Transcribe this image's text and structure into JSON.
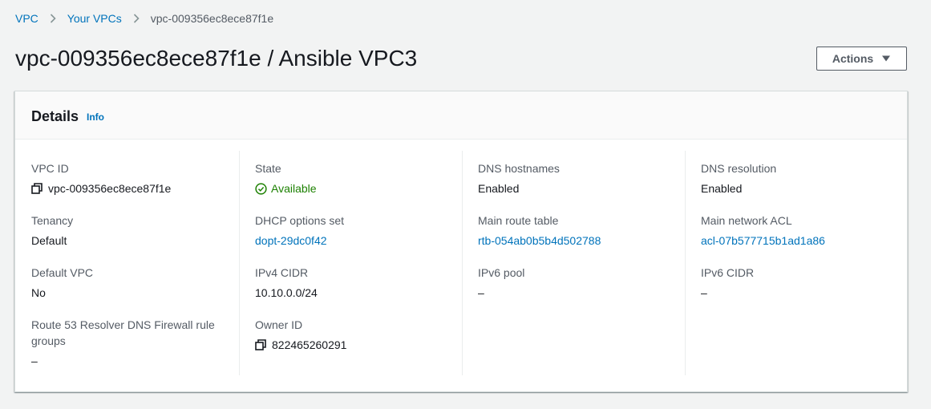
{
  "breadcrumb": {
    "items": [
      "VPC",
      "Your VPCs"
    ],
    "current": "vpc-009356ec8ece87f1e"
  },
  "title": "vpc-009356ec8ece87f1e / Ansible VPC3",
  "actions": {
    "label": "Actions",
    "icon": "caret-down-icon"
  },
  "details": {
    "title": "Details",
    "info_label": "Info",
    "columns": [
      [
        {
          "label": "VPC ID",
          "value": "vpc-009356ec8ece87f1e",
          "icon": "copy-icon"
        },
        {
          "label": "Tenancy",
          "value": "Default"
        },
        {
          "label": "Default VPC",
          "value": "No"
        },
        {
          "label": "Route 53 Resolver DNS Firewall rule groups",
          "value": "–"
        }
      ],
      [
        {
          "label": "State",
          "value": "Available",
          "icon": "check-circle-icon"
        },
        {
          "label": "DHCP options set",
          "value": "dopt-29dc0f42",
          "link": true
        },
        {
          "label": "IPv4 CIDR",
          "value": "10.10.0.0/24"
        },
        {
          "label": "Owner ID",
          "value": "822465260291",
          "icon": "copy-icon"
        }
      ],
      [
        {
          "label": "DNS hostnames",
          "value": "Enabled"
        },
        {
          "label": "Main route table",
          "value": "rtb-054ab0b5b4d502788",
          "link": true
        },
        {
          "label": "IPv6 pool",
          "value": "–"
        }
      ],
      [
        {
          "label": "DNS resolution",
          "value": "Enabled"
        },
        {
          "label": "Main network ACL",
          "value": "acl-07b577715b1ad1a86",
          "link": true
        },
        {
          "label": "IPv6 CIDR",
          "value": "–"
        }
      ]
    ]
  },
  "colors": {
    "link": "#0073bb",
    "success": "#1d8102",
    "background": "#f2f3f3"
  }
}
